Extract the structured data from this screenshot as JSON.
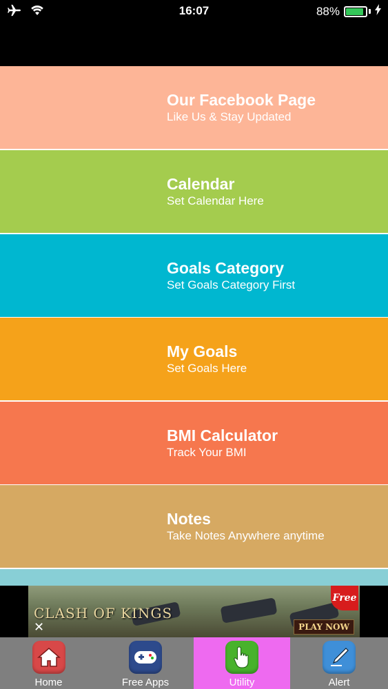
{
  "status_bar": {
    "time": "16:07",
    "battery_percent": "88%",
    "battery_level": 0.88,
    "icons": [
      "airplane-icon",
      "wifi-icon",
      "battery-icon",
      "charging-bolt-icon"
    ]
  },
  "menu": {
    "items": [
      {
        "title": "Our Facebook Page",
        "subtitle": "Like Us & Stay Updated",
        "color": "#FDB597"
      },
      {
        "title": "Calendar",
        "subtitle": "Set Calendar Here",
        "color": "#A4CC4E"
      },
      {
        "title": "Goals Category",
        "subtitle": "Set Goals Category First",
        "color": "#00B7D0"
      },
      {
        "title": "My Goals",
        "subtitle": "Set Goals Here",
        "color": "#F5A21A"
      },
      {
        "title": "BMI Calculator",
        "subtitle": "Track Your BMI",
        "color": "#F6774E"
      },
      {
        "title": "Notes",
        "subtitle": "Take Notes Anywhere anytime",
        "color": "#D6A962"
      },
      {
        "title": "",
        "subtitle": "",
        "color": "#88CFD6"
      }
    ]
  },
  "ad": {
    "logo_text": "CLASH OF KINGS",
    "badge": "Free",
    "cta": "PLAY NOW",
    "close": "✕"
  },
  "tab_bar": {
    "active_color": "#EE6AF0",
    "tabs": [
      {
        "label": "Home",
        "icon": "home-icon",
        "icon_color": "#D84848",
        "active": false
      },
      {
        "label": "Free Apps",
        "icon": "gamepad-icon",
        "icon_color": "#2D4A8C",
        "active": false
      },
      {
        "label": "Utility",
        "icon": "hand-pointer-icon",
        "icon_color": "#48B22C",
        "active": true
      },
      {
        "label": "Alert",
        "icon": "pen-icon",
        "icon_color": "#3F8FD8",
        "active": false
      }
    ]
  }
}
